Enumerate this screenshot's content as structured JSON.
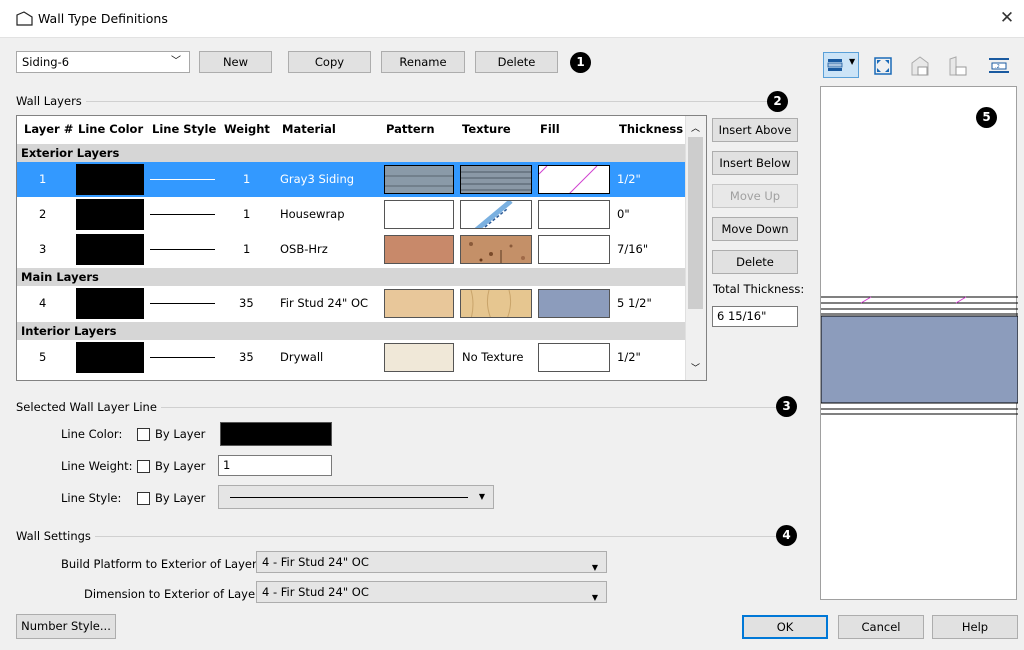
{
  "window": {
    "title": "Wall Type Definitions",
    "close_symbol": "✕"
  },
  "top": {
    "wall_type_value": "Siding-6",
    "buttons": {
      "new": "New",
      "copy": "Copy",
      "rename": "Rename",
      "delete": "Delete"
    }
  },
  "badges": [
    "1",
    "2",
    "3",
    "4",
    "5"
  ],
  "layers": {
    "group_label": "Wall Layers",
    "columns": [
      "Layer #",
      "Line Color",
      "Line Style",
      "Weight",
      "Material",
      "Pattern",
      "Texture",
      "Fill",
      "Thickness"
    ],
    "sections": {
      "exterior": "Exterior Layers",
      "main": "Main Layers",
      "interior": "Interior Layers"
    },
    "rows": [
      {
        "num": "1",
        "weight": "1",
        "material": "Gray3 Siding",
        "thickness": "1/2\"",
        "texture_text": ""
      },
      {
        "num": "2",
        "weight": "1",
        "material": "Housewrap",
        "thickness": "0\"",
        "texture_text": ""
      },
      {
        "num": "3",
        "weight": "1",
        "material": "OSB-Hrz",
        "thickness": "7/16\"",
        "texture_text": ""
      },
      {
        "num": "4",
        "weight": "35",
        "material": "Fir Stud 24\" OC",
        "thickness": "5 1/2\"",
        "texture_text": ""
      },
      {
        "num": "5",
        "weight": "35",
        "material": "Drywall",
        "thickness": "1/2\"",
        "texture_text": "No Texture"
      }
    ],
    "side_buttons": {
      "insert_above": "Insert Above",
      "insert_below": "Insert Below",
      "move_up": "Move Up",
      "move_down": "Move Down",
      "delete": "Delete"
    },
    "total_thickness_label": "Total Thickness:",
    "total_thickness_value": "6 15/16\""
  },
  "line": {
    "group_label": "Selected Wall Layer Line",
    "color_label": "Line Color:",
    "weight_label": "Line Weight:",
    "style_label": "Line Style:",
    "by_layer": "By Layer",
    "weight_value": "1"
  },
  "wall_settings": {
    "group_label": "Wall Settings",
    "build_label": "Build Platform to Exterior of Layer:",
    "build_value": "4 - Fir Stud 24\" OC",
    "dimension_label": "Dimension to Exterior of Layer:",
    "dimension_value": "4 - Fir Stud 24\" OC"
  },
  "footer": {
    "number_style": "Number Style...",
    "ok": "OK",
    "cancel": "Cancel",
    "help": "Help"
  },
  "colors": {
    "selection": "#3399ff",
    "siding_pattern": "#8a9aa8",
    "osb": "#c8896a",
    "fir": "#e8c79a",
    "drywall": "#f0e8d8",
    "stud_fill": "#8c9cbc",
    "accent": "#0078d7"
  },
  "icons": [
    "wall-type-icon",
    "dropdown-icon",
    "fill-window-icon",
    "view-front-icon",
    "view-side-icon",
    "layer-icon"
  ]
}
